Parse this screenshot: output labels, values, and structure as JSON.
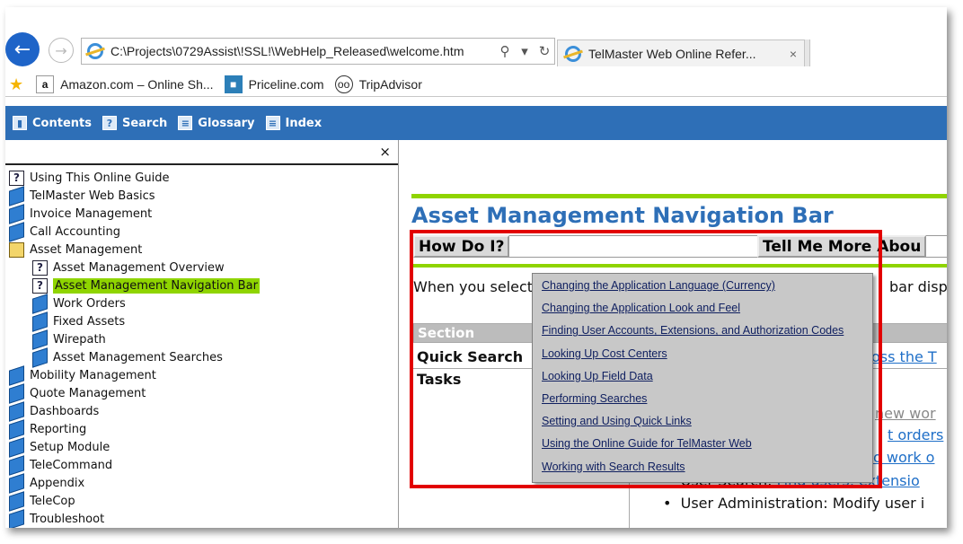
{
  "browser": {
    "address": "C:\\Projects\\0729Assist\\!SSL!\\WebHelp_Released\\welcome.htm",
    "tab_title": "TelMaster Web Online Refer...",
    "tab_close": "×",
    "favorites": [
      {
        "label": "Amazon.com – Online Sh...",
        "icon": "amazon-icon"
      },
      {
        "label": "Priceline.com",
        "icon": "priceline-icon"
      },
      {
        "label": "TripAdvisor",
        "icon": "tripadvisor-icon"
      }
    ]
  },
  "helpbar": {
    "items": [
      {
        "label": "Contents",
        "icon": "contents-book-icon"
      },
      {
        "label": "Search",
        "icon": "search-help-icon"
      },
      {
        "label": "Glossary",
        "icon": "glossary-icon"
      },
      {
        "label": "Index",
        "icon": "index-icon"
      }
    ]
  },
  "toc": {
    "close": "×",
    "items": [
      {
        "label": "Using This Online Guide",
        "icon": "page-icon",
        "level": 0
      },
      {
        "label": "TelMaster Web Basics",
        "icon": "book-icon",
        "level": 0
      },
      {
        "label": "Invoice Management",
        "icon": "book-icon",
        "level": 0
      },
      {
        "label": "Call Accounting",
        "icon": "book-icon",
        "level": 0
      },
      {
        "label": "Asset Management",
        "icon": "open-book-icon",
        "level": 0
      },
      {
        "label": "Asset Management Overview",
        "icon": "page-icon",
        "level": 1
      },
      {
        "label": "Asset Management Navigation Bar",
        "icon": "page-icon",
        "level": 1,
        "selected": true
      },
      {
        "label": "Work Orders",
        "icon": "book-icon",
        "level": 1
      },
      {
        "label": "Fixed Assets",
        "icon": "book-icon",
        "level": 1
      },
      {
        "label": "Wirepath",
        "icon": "book-icon",
        "level": 1
      },
      {
        "label": "Asset Management Searches",
        "icon": "book-icon",
        "level": 1
      },
      {
        "label": "Mobility Management",
        "icon": "book-icon",
        "level": 0
      },
      {
        "label": "Quote Management",
        "icon": "book-icon",
        "level": 0
      },
      {
        "label": "Dashboards",
        "icon": "book-icon",
        "level": 0
      },
      {
        "label": "Reporting",
        "icon": "book-icon",
        "level": 0
      },
      {
        "label": "Setup Module",
        "icon": "book-icon",
        "level": 0
      },
      {
        "label": "TeleCommand",
        "icon": "book-icon",
        "level": 0
      },
      {
        "label": "Appendix",
        "icon": "book-icon",
        "level": 0
      },
      {
        "label": "TeleCop",
        "icon": "book-icon",
        "level": 0
      },
      {
        "label": "Troubleshoot",
        "icon": "book-icon",
        "level": 0
      }
    ]
  },
  "topic": {
    "title": "Asset Management Navigation Bar",
    "how_do_i": "How Do I?",
    "tell_me_more": "Tell Me More Abou",
    "intro": "When you select",
    "intro_tail": "bar displ",
    "table": {
      "header": "Section",
      "row1": "Quick Search",
      "row2": "Tasks",
      "link1": "oss the T",
      "faint": "new wor",
      "link2": "t orders",
      "link3": "o work o",
      "bullet1_text": "User Search: ",
      "bullet1_link": "Find users, extensio",
      "bullet2": "User Administration: Modify user i"
    }
  },
  "popup": {
    "links": [
      "Changing the Application Language (Currency)",
      "Changing the Application Look and Feel",
      "Finding User Accounts, Extensions, and Authorization Codes",
      "Looking Up Cost Centers",
      "Looking Up Field Data",
      "Performing Searches",
      "Setting and Using Quick Links",
      "Using the Online Guide for TelMaster Web",
      "Working with Search Results"
    ]
  },
  "colors": {
    "accent": "#2e6fb7",
    "highlight": "#8fd400",
    "callout": "#e20000"
  }
}
